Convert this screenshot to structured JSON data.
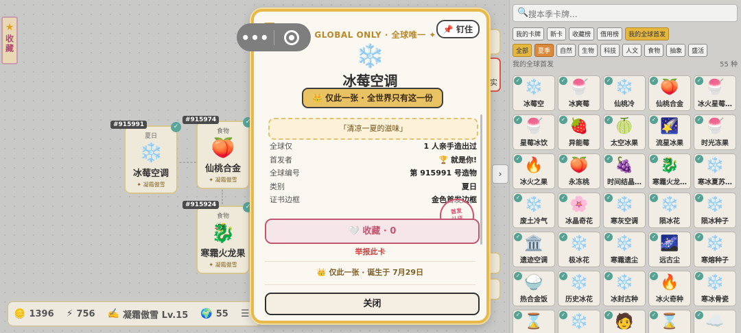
{
  "sidebar_tab": {
    "label": "收藏"
  },
  "canvas": {
    "nodes": [
      {
        "id": "#915991",
        "category": "夏日",
        "emoji": "❄️",
        "name": "冰莓空调",
        "badge": "✦ 凝霜傲雪"
      },
      {
        "id": "#915974",
        "category": "食物",
        "emoji": "🍑",
        "name": "仙桃合金",
        "badge": "✦ 凝霜傲雪"
      },
      {
        "id": "#915924",
        "category": "食物",
        "emoji": "🐉",
        "name": "寒霜火龙果",
        "badge": "✦ 凝霜傲雪"
      }
    ],
    "right_stub_text": "实"
  },
  "stats": {
    "coins": "1396",
    "energy": "756",
    "level": "凝霜傲雪 Lv.15",
    "globe": "55",
    "more": "更多"
  },
  "panel": {
    "search_placeholder": "搜本季卡牌...",
    "tabs": [
      "我的卡牌",
      "新卡",
      "收藏榜",
      "借用榜",
      "我的全球首发"
    ],
    "filters": [
      "全部",
      "夏季",
      "自然",
      "生物",
      "科技",
      "人文",
      "食物",
      "抽象",
      "盛活"
    ],
    "section_title": "我的全球首发",
    "section_count": "55 种",
    "cards": [
      {
        "emoji": "❄️",
        "label": "冰莓空"
      },
      {
        "emoji": "🍧",
        "label": "冰爽莓"
      },
      {
        "emoji": "❄️",
        "label": "仙桃冷"
      },
      {
        "emoji": "🍑",
        "label": "仙桃合金"
      },
      {
        "emoji": "🍧",
        "label": "冰火星莓…"
      },
      {
        "emoji": "🍧",
        "label": "星莓冰饮"
      },
      {
        "emoji": "🍓",
        "label": "异能莓"
      },
      {
        "emoji": "🍈",
        "label": "太空冰果"
      },
      {
        "emoji": "🌠",
        "label": "流星冰果"
      },
      {
        "emoji": "🍧",
        "label": "时光冻果"
      },
      {
        "emoji": "🔥",
        "label": "冰火之果"
      },
      {
        "emoji": "🍑",
        "label": "永冻桃"
      },
      {
        "emoji": "🍇",
        "label": "时间结晶…"
      },
      {
        "emoji": "🐉",
        "label": "寒霜火龙…"
      },
      {
        "emoji": "❄️",
        "label": "寒冰夏苏…"
      },
      {
        "emoji": "❄️",
        "label": "废土冷气"
      },
      {
        "emoji": "🌸",
        "label": "冰晶奇花"
      },
      {
        "emoji": "❄️",
        "label": "寒灰空调"
      },
      {
        "emoji": "❄️",
        "label": "陨冰花"
      },
      {
        "emoji": "❄️",
        "label": "陨冰种子"
      },
      {
        "emoji": "🏛️",
        "label": "遗迹空调"
      },
      {
        "emoji": "❄️",
        "label": "极冰花"
      },
      {
        "emoji": "❄️",
        "label": "寒霜遗尘"
      },
      {
        "emoji": "🌌",
        "label": "远古尘"
      },
      {
        "emoji": "❄️",
        "label": "寒熔种子"
      },
      {
        "emoji": "🍚",
        "label": "热合金饭"
      },
      {
        "emoji": "❄️",
        "label": "历史冰花"
      },
      {
        "emoji": "❄️",
        "label": "冰封古种"
      },
      {
        "emoji": "🔥",
        "label": "冰火奇种"
      },
      {
        "emoji": "❄️",
        "label": "寒冰骨瓷"
      },
      {
        "emoji": "⌛",
        "label": ""
      },
      {
        "emoji": "❄️",
        "label": ""
      },
      {
        "emoji": "🧑",
        "label": ""
      },
      {
        "emoji": "⌛",
        "label": ""
      },
      {
        "emoji": "☁️",
        "label": ""
      }
    ]
  },
  "modal": {
    "pin_label": "钉住",
    "global_label": "✦ GLOBAL ONLY · 全球唯一 ✦",
    "icon": "❄️",
    "title": "冰莓空调",
    "unique_label": "👑 仅此一张 · 全世界只有这一份",
    "quote": "「清凉一夏的滋味」",
    "info": [
      {
        "k": "全球仅",
        "v": "1 人亲手造出过"
      },
      {
        "k": "首发者",
        "v": "🏆 就是你!"
      },
      {
        "k": "全球编号",
        "v": "第 915991 号造物"
      },
      {
        "k": "类别",
        "v": "夏日"
      },
      {
        "k": "证书边框",
        "v": "金色首发边框"
      }
    ],
    "stamp_line1": "首发",
    "stamp_line2": "认证",
    "fav_label": "🤍 收藏 · 0",
    "report_label": "举报此卡",
    "born_label": "👑 仅此一张 · 诞生于 7月29日",
    "close_label": "关闭"
  }
}
